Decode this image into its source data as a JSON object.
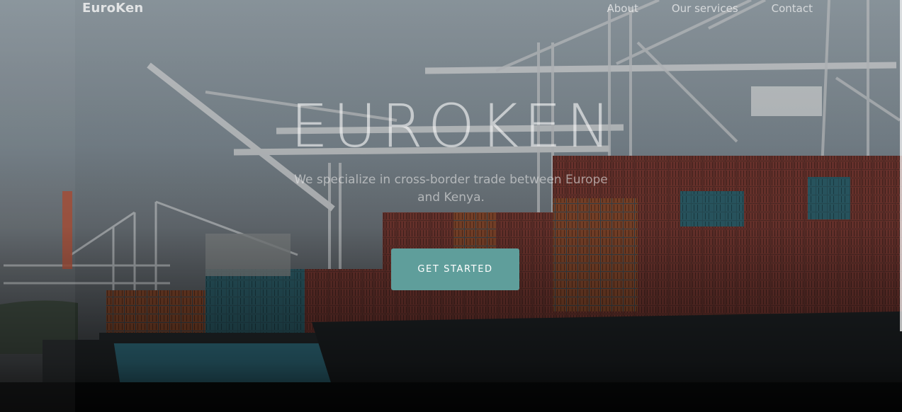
{
  "navbar": {
    "brand": "EuroKen",
    "links": [
      {
        "label": "About"
      },
      {
        "label": "Our services"
      },
      {
        "label": "Contact"
      }
    ]
  },
  "hero": {
    "title": "EUROKEN",
    "subtitle": "We specialize in cross-border trade between Europe and Kenya.",
    "cta_label": "GET STARTED",
    "background": "cargo-port-cranes-container-ship-photo"
  },
  "colors": {
    "accent": "#5f9e9b",
    "text_light": "#f5f5f5"
  }
}
